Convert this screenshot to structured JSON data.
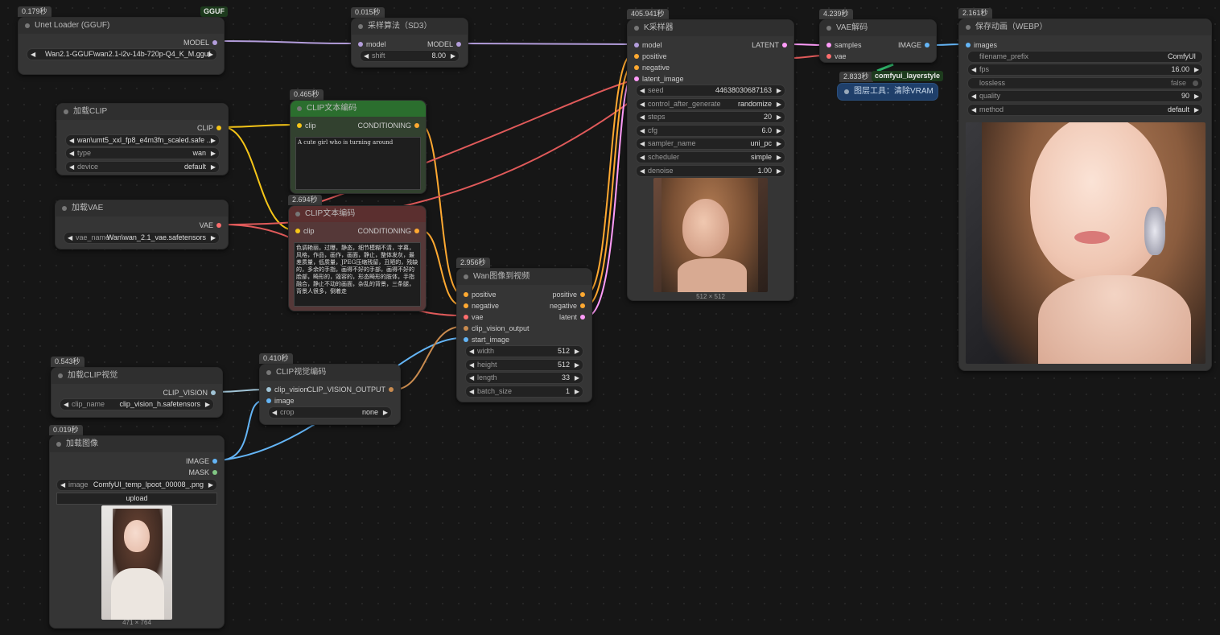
{
  "colors": {
    "model": "#b39ddb",
    "clip": "#f5c518",
    "conditioning": "#ffa931",
    "vae": "#ff6e6e",
    "latent": "#ff9cf9",
    "image": "#64b5f6",
    "clip_vision": "#a1c4d6",
    "clip_vision_output": "#c98b4f",
    "mask": "#81c784"
  },
  "unet": {
    "timing": "0.179秒",
    "badge": "GGUF",
    "title": "Unet Loader (GGUF)",
    "out_model": "MODEL",
    "unet_name": "Wan2.1-GGUF\\wan2.1-i2v-14b-720p-Q4_K_M.gguf"
  },
  "sampling": {
    "timing": "0.015秒",
    "title": "采样算法（SD3）",
    "in_model": "model",
    "out_model": "MODEL",
    "shift_label": "shift",
    "shift_value": "8.00"
  },
  "ksampler": {
    "timing": "405.941秒",
    "title": "K采样器",
    "in_model": "model",
    "in_positive": "positive",
    "in_negative": "negative",
    "in_latent": "latent_image",
    "out_latent": "LATENT",
    "widgets": [
      {
        "label": "seed",
        "value": "446380306871​63"
      },
      {
        "label": "control_after_generate",
        "value": "randomize"
      },
      {
        "label": "steps",
        "value": "20"
      },
      {
        "label": "cfg",
        "value": "6.0"
      },
      {
        "label": "sampler_name",
        "value": "uni_pc"
      },
      {
        "label": "scheduler",
        "value": "simple"
      },
      {
        "label": "denoise",
        "value": "1.00"
      }
    ],
    "preview_size": "512 × 512"
  },
  "vaedecode": {
    "timing": "4.239秒",
    "title": "VAE解码",
    "in_samples": "samples",
    "in_vae": "vae",
    "out_image": "IMAGE"
  },
  "layerstyle": {
    "timing": "2.833秒",
    "badge": "comfyui_layerstyle",
    "title": "图层工具：清除VRAM"
  },
  "save": {
    "timing": "2.161秒",
    "title": "保存动画（WEBP）",
    "in_images": "images",
    "widgets": [
      {
        "label": "filename_prefix",
        "value": "ComfyUI"
      },
      {
        "label": "fps",
        "value": "16.00"
      },
      {
        "label": "lossless",
        "value": "false"
      },
      {
        "label": "quality",
        "value": "90"
      },
      {
        "label": "method",
        "value": "default"
      }
    ]
  },
  "loadclip": {
    "title": "加载CLIP",
    "out_clip": "CLIP",
    "clip_name": "wan\\umt5_xxl_fp8_e4m3fn_scaled.safe ...",
    "type_label": "type",
    "type_value": "wan",
    "device_label": "device",
    "device_value": "default"
  },
  "clippos": {
    "timing": "0.465秒",
    "title": "CLIP文本编码",
    "in_clip": "clip",
    "out_cond": "CONDITIONING",
    "text": "A cute girl who is turning around"
  },
  "loadvae": {
    "title": "加载VAE",
    "out_vae": "VAE",
    "vae_label": "vae_name",
    "vae_value": "Wan\\wan_2.1_vae.safetensors"
  },
  "clipneg": {
    "timing": "2.694秒",
    "title": "CLIP文本编码",
    "in_clip": "clip",
    "out_cond": "CONDITIONING",
    "text": "色调艳丽，过曝，静态，细节模糊不清，字幕，风格，作品，画作，画面，静止，整体发灰，最差质量，低质量，JPEG压缩残留，丑陋的，残缺的，多余的手指，画得不好的手部，画得不好的脸部，畸形的，毁容的，形态畸形的肢体，手指融合，静止不动的画面，杂乱的背景，三条腿，背景人很多，倒着走"
  },
  "wan": {
    "timing": "2.956秒",
    "title": "Wan图像到视频",
    "in_positive": "positive",
    "in_negative": "negative",
    "in_vae": "vae",
    "in_clip_vision_output": "clip_vision_output",
    "in_start_image": "start_image",
    "out_positive": "positive",
    "out_negative": "negative",
    "out_latent": "latent",
    "widgets": [
      {
        "label": "width",
        "value": "512"
      },
      {
        "label": "height",
        "value": "512"
      },
      {
        "label": "length",
        "value": "33"
      },
      {
        "label": "batch_size",
        "value": "1"
      }
    ]
  },
  "loadclipvision": {
    "timing": "0.543秒",
    "title": "加载CLIP视觉",
    "out": "CLIP_VISION",
    "clip_label": "clip_name",
    "clip_value": "clip_vision_h.safetensors"
  },
  "clipvisionenc": {
    "timing": "0.410秒",
    "title": "CLIP视觉编码",
    "in_clip_vision": "clip_vision",
    "in_image": "image",
    "out": "CLIP_VISION_OUTPUT",
    "crop_label": "crop",
    "crop_value": "none"
  },
  "loadimage": {
    "timing": "0.019秒",
    "title": "加载图像",
    "out_image": "IMAGE",
    "out_mask": "MASK",
    "image_label": "image",
    "image_value": "ComfyUI_temp_lpoot_00008_.png",
    "upload": "upload",
    "size": "471 × 764"
  }
}
